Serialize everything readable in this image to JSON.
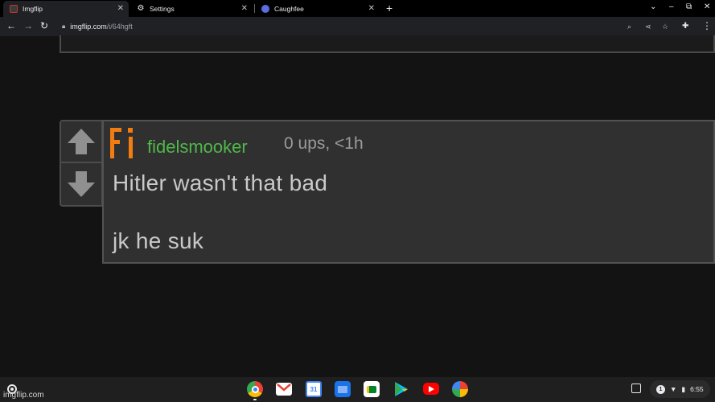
{
  "browser": {
    "tabs": [
      {
        "title": "Imgflip",
        "active": true
      },
      {
        "title": "Settings",
        "active": false
      },
      {
        "title": "Caughfee",
        "active": false
      }
    ],
    "url_host": "imgflip.com",
    "url_path": "/i/64hgft"
  },
  "comment": {
    "avatar_letters": "Fi",
    "username": "fidelsmooker",
    "meta": "0 ups, <1h",
    "line1": "Hitler wasn't that bad",
    "line2": "jk he suk",
    "username_color": "#4fb84a",
    "avatar_color": "#f07c12"
  },
  "shelf": {
    "apps": [
      "chrome-icon",
      "gmail-icon",
      "calendar-icon",
      "files-icon",
      "meet-icon",
      "play-store-icon",
      "youtube-icon",
      "photos-icon"
    ],
    "notification_count": "1",
    "time": "6:55"
  },
  "watermark": "imgflip.com"
}
